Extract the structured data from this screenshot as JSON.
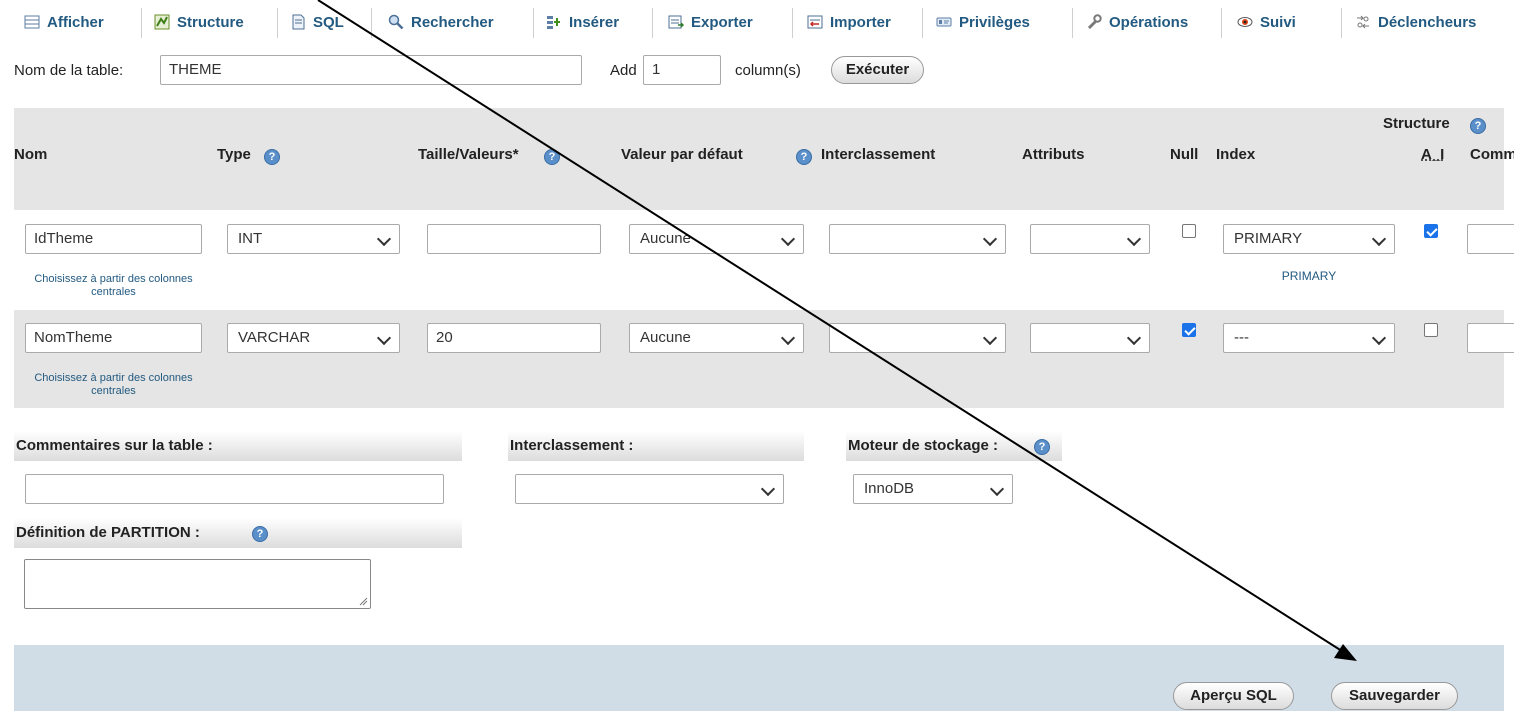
{
  "nav": {
    "tabs": [
      {
        "label": "Afficher",
        "icon": "browse-icon"
      },
      {
        "label": "Structure",
        "icon": "structure-icon"
      },
      {
        "label": "SQL",
        "icon": "sql-icon"
      },
      {
        "label": "Rechercher",
        "icon": "search-icon"
      },
      {
        "label": "Insérer",
        "icon": "insert-icon"
      },
      {
        "label": "Exporter",
        "icon": "export-icon"
      },
      {
        "label": "Importer",
        "icon": "import-icon"
      },
      {
        "label": "Privilèges",
        "icon": "privileges-icon"
      },
      {
        "label": "Opérations",
        "icon": "operations-icon"
      },
      {
        "label": "Suivi",
        "icon": "tracking-icon"
      },
      {
        "label": "Déclencheurs",
        "icon": "triggers-icon"
      }
    ]
  },
  "tablebar": {
    "name_label": "Nom de la table:",
    "name_value": "THEME",
    "add_label": "Add",
    "add_value": "1",
    "columns_label": "column(s)",
    "execute_label": "Exécuter"
  },
  "grid": {
    "structure_label": "Structure",
    "headers": {
      "nom": "Nom",
      "type": "Type",
      "taille": "Taille/Valeurs*",
      "defaut": "Valeur par défaut",
      "interclassement": "Interclassement",
      "attributs": "Attributs",
      "null": "Null",
      "index": "Index",
      "ai": "A_I",
      "comm": "Comm"
    },
    "central_hint": "Choisissez à partir des colonnes centrales",
    "rows": [
      {
        "name": "IdTheme",
        "type": "INT",
        "size": "",
        "default": "Aucune",
        "collation": "",
        "attribute": "",
        "null": false,
        "index": "PRIMARY",
        "index_note": "PRIMARY",
        "ai": true
      },
      {
        "name": "NomTheme",
        "type": "VARCHAR",
        "size": "20",
        "default": "Aucune",
        "collation": "",
        "attribute": "",
        "null": true,
        "index": "---",
        "index_note": "",
        "ai": false
      }
    ]
  },
  "options": {
    "comments_label": "Commentaires sur la table :",
    "comments_value": "",
    "collation_label": "Interclassement :",
    "collation_value": "",
    "engine_label": "Moteur de stockage :",
    "engine_value": "InnoDB",
    "partition_label": "Définition de PARTITION :",
    "partition_value": ""
  },
  "footer": {
    "preview_label": "Aperçu SQL",
    "save_label": "Sauvegarder"
  },
  "colors": {
    "link": "#235a81",
    "header_band": "#e5e5e5",
    "row_band": "#e5e5e5",
    "footer_band": "#d1dde6",
    "checkbox_on": "#1a73e8"
  }
}
